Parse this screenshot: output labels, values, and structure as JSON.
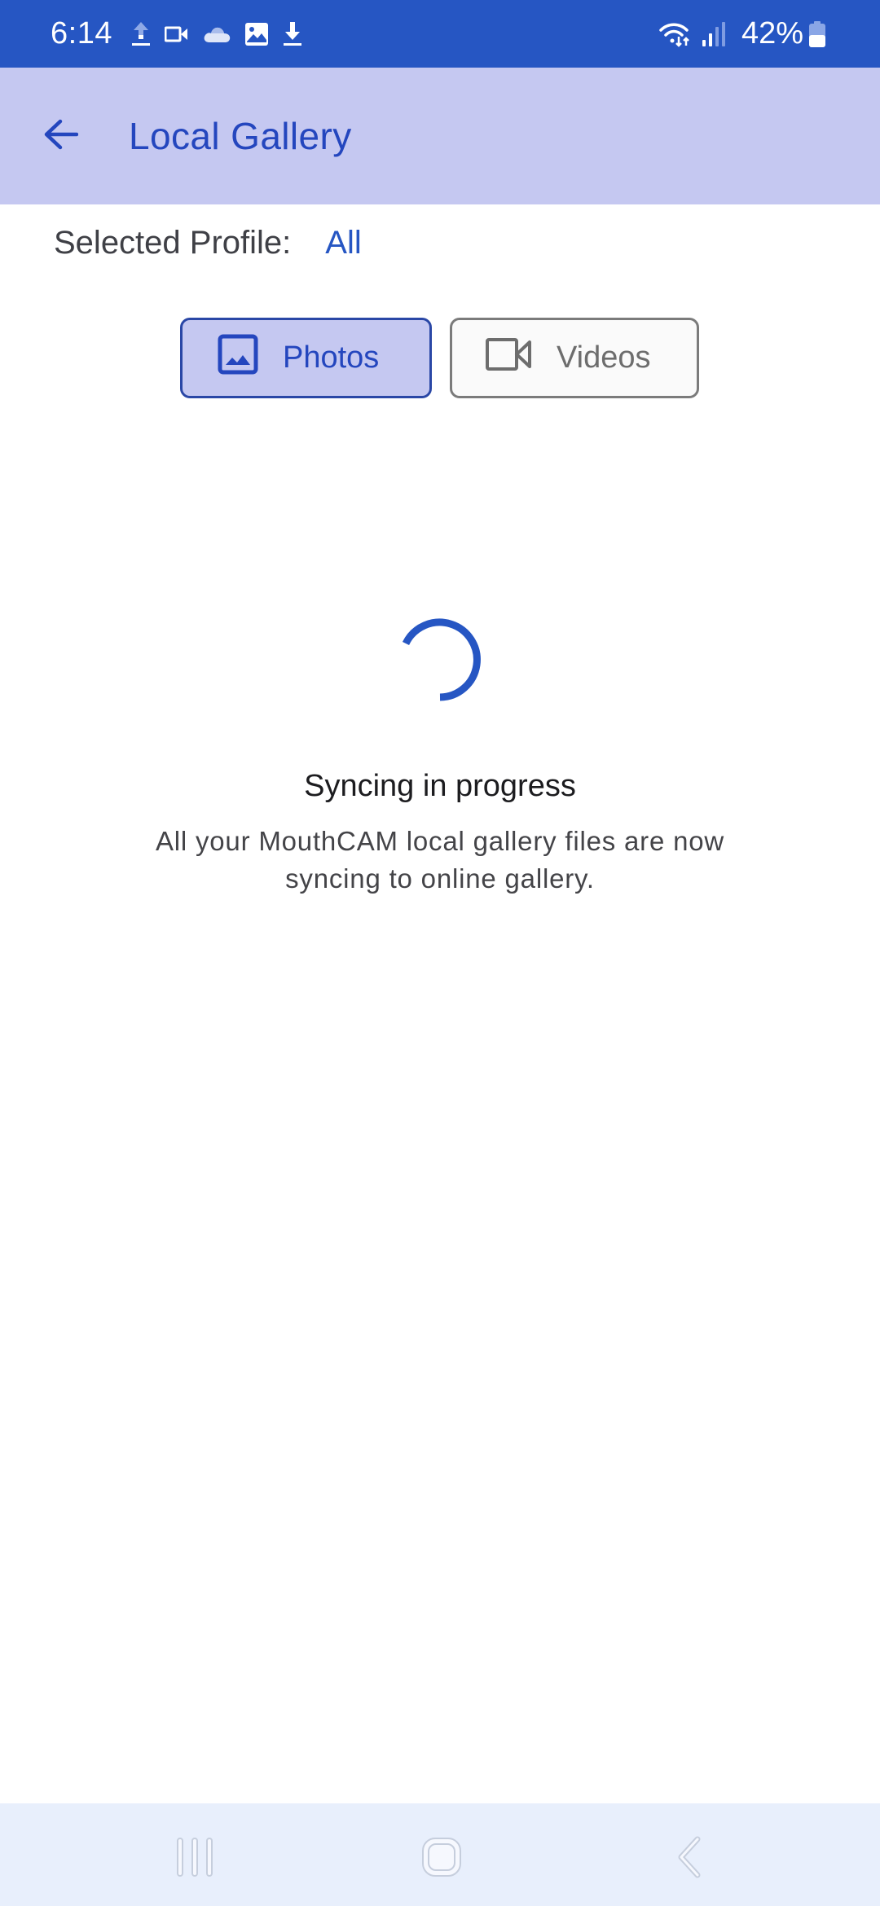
{
  "status_bar": {
    "time": "6:14",
    "left_icons": [
      "upload-icon",
      "video-camera-icon",
      "cloud-icon",
      "image-icon",
      "download-icon"
    ],
    "right_icons": [
      "wifi-data-icon",
      "signal-icon",
      "battery-icon"
    ],
    "battery_percent": "42%",
    "battery_level": 0.42,
    "background_color": "#2656c3"
  },
  "app_bar": {
    "back_icon": "arrow-left-icon",
    "title": "Local Gallery",
    "background_color": "#c5c8f1",
    "title_color": "#2446be"
  },
  "profile": {
    "label": "Selected Profile:",
    "value": "All",
    "value_color": "#2656c3"
  },
  "media_toggle": {
    "options": [
      {
        "label": "Photos",
        "icon": "image-icon",
        "selected": true
      },
      {
        "label": "Videos",
        "icon": "video-camera-icon",
        "selected": false
      }
    ],
    "selected_color": "#c5c8f1"
  },
  "sync": {
    "spinner_icon": "loading-spinner-icon",
    "title": "Syncing in progress",
    "description": "All your MouthCAM local gallery files are now syncing to online gallery.",
    "accent_color": "#2656c3"
  },
  "nav_bar": {
    "buttons": [
      {
        "name": "recents",
        "icon": "recents-icon"
      },
      {
        "name": "home",
        "icon": "home-icon"
      },
      {
        "name": "back",
        "icon": "back-chevron-icon"
      }
    ]
  }
}
